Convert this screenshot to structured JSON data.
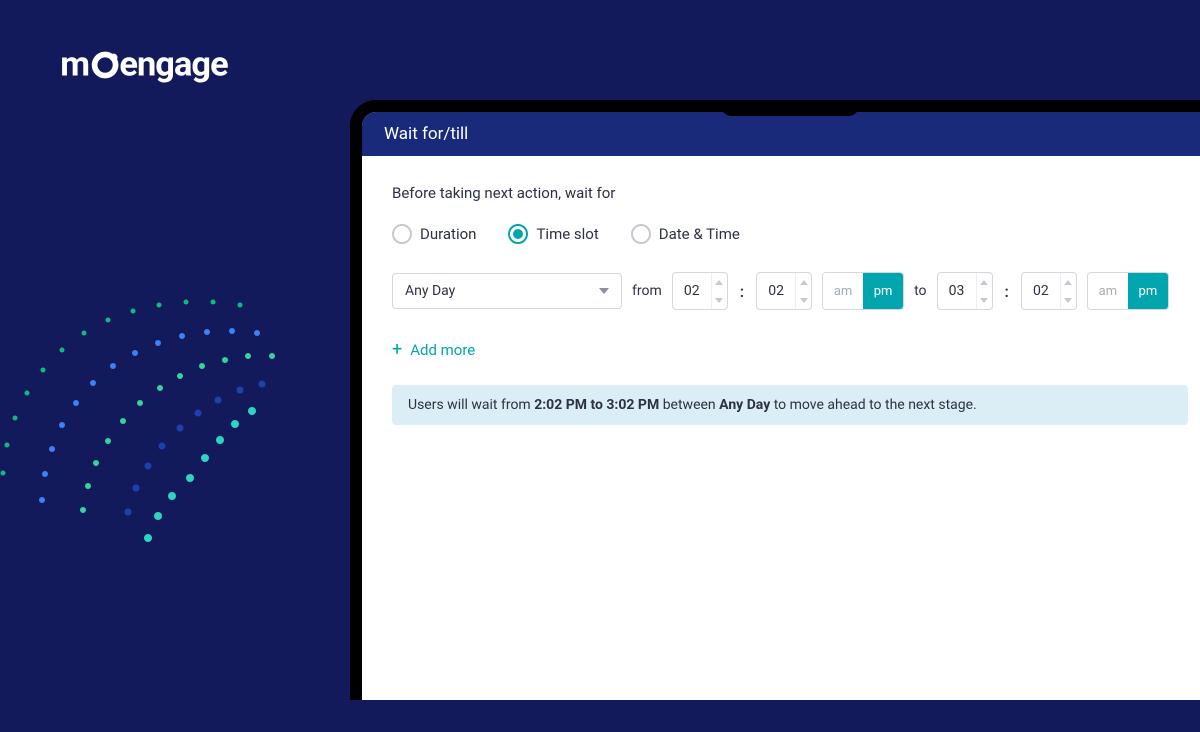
{
  "brand": "moengage",
  "panel": {
    "title": "Wait for/till",
    "prompt": "Before taking next action, wait for",
    "radios": {
      "duration": "Duration",
      "timeslot": "Time slot",
      "datetime": "Date & Time",
      "selected": "timeslot"
    },
    "slot": {
      "day": "Any Day",
      "from_label": "from",
      "to_label": "to",
      "colon": ":",
      "from_h": "02",
      "from_m": "02",
      "to_h": "03",
      "to_m": "02",
      "am": "am",
      "pm": "pm"
    },
    "add_more": "Add more",
    "summary": {
      "prefix": "Users will wait from ",
      "range": "2:02 PM to 3:02 PM",
      "mid": " between ",
      "day": "Any Day",
      "suffix": " to move ahead to the next stage."
    }
  }
}
